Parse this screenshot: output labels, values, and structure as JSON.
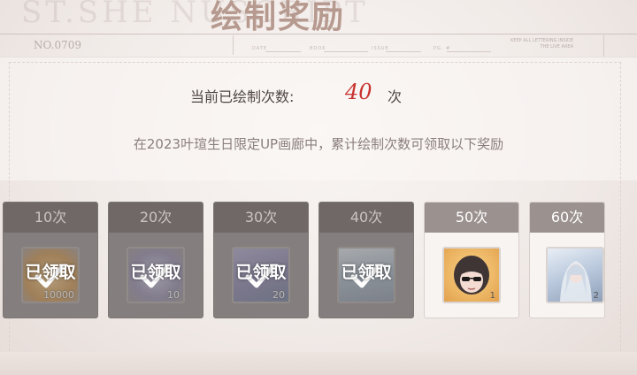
{
  "header": {
    "watermark": "ST.SHE           NUSCRIPT",
    "title": "绘制奖励",
    "serial": "NO.0709",
    "fields": [
      "DATE",
      "BOOK",
      "ISSUE",
      "PG. #"
    ],
    "corner_note": "KEEP ALL LETTERING INSIDE THE LIVE AREA"
  },
  "summary": {
    "label": "当前已绘制次数:",
    "count": "40",
    "unit": "次",
    "description": "在2023叶瑄生日限定UP画廊中，累计绘制次数可领取以下奖励"
  },
  "rewards": [
    {
      "threshold": "10次",
      "quantity": "10000",
      "status": "claimed",
      "status_text": "已领取",
      "icon": "coin-icon",
      "color": "#e0a957"
    },
    {
      "threshold": "20次",
      "quantity": "10",
      "status": "claimed",
      "status_text": "已领取",
      "icon": "stamp-icon",
      "color": "#8b84a8"
    },
    {
      "threshold": "30次",
      "quantity": "20",
      "status": "claimed",
      "status_text": "已领取",
      "icon": "gift-icon",
      "color": "#7d79a6"
    },
    {
      "threshold": "40次",
      "quantity": "",
      "status": "claimed",
      "status_text": "已领取",
      "icon": "card-art-icon",
      "color": "#9eb2c3"
    },
    {
      "threshold": "50次",
      "quantity": "1",
      "status": "available",
      "status_text": "",
      "icon": "avatar-icon",
      "color": "#e2a14d"
    },
    {
      "threshold": "60次",
      "quantity": "2",
      "status": "available",
      "status_text": "",
      "icon": "character-art-icon",
      "color": "#b9c8dc"
    }
  ]
}
